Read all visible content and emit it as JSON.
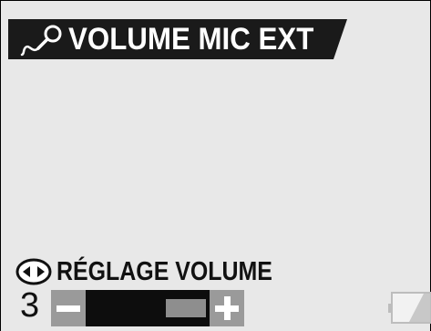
{
  "header": {
    "title": "VOLUME MIC EXT",
    "icon": "microphone-icon",
    "background_color": "#1a1a1a",
    "text_color": "#ffffff"
  },
  "adjust": {
    "icon": "left-right-arrows-icon",
    "label": "RÉGLAGE VOLUME"
  },
  "volume": {
    "value": "3",
    "level_fraction": 0.6,
    "minus_icon": "minus-icon",
    "plus_icon": "plus-icon"
  },
  "status": {
    "battery_icon": "battery-icon"
  },
  "colors": {
    "screen_background": "#e8e8e8",
    "bar_gray": "#9a9a9a",
    "bar_fill": "#0d0d0d"
  }
}
